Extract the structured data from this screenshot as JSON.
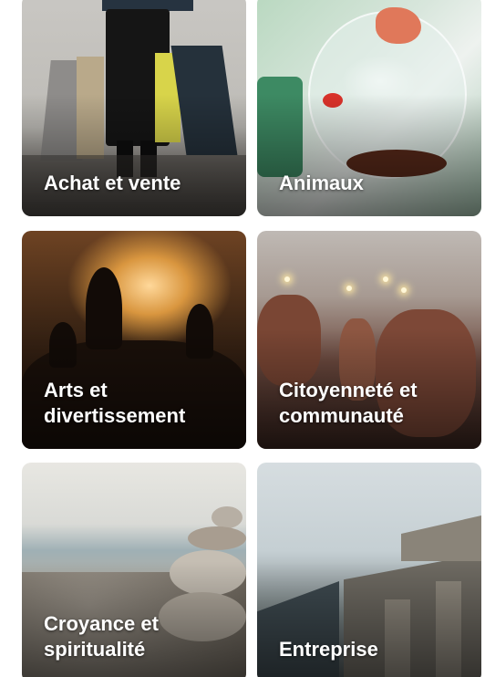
{
  "categories": [
    {
      "label": "Achat et vente",
      "image": "shopping-bags-photo"
    },
    {
      "label": "Animaux",
      "image": "fish-bowl-photo"
    },
    {
      "label": "Arts et\ndivertissement",
      "image": "concert-crowd-photo"
    },
    {
      "label": "Citoyenneté et\ncommunauté",
      "image": "sparklers-photo"
    },
    {
      "label": "Croyance et\nspiritualité",
      "image": "stacked-stones-photo"
    },
    {
      "label": "Entreprise",
      "image": "building-photo"
    }
  ]
}
